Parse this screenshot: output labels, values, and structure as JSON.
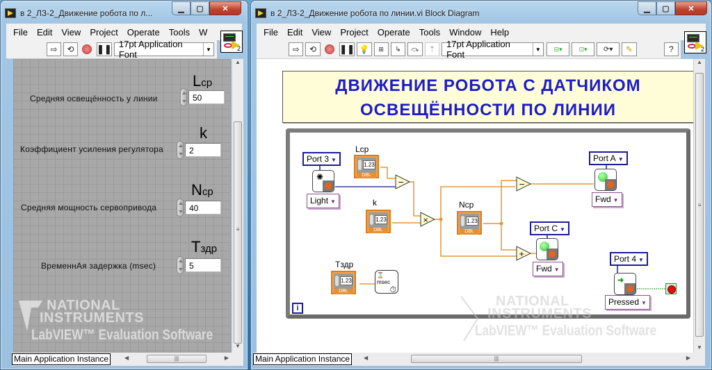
{
  "front_panel": {
    "title": "в 2_ЛЗ-2_Движение робота по л...",
    "menu": [
      "File",
      "Edit",
      "View",
      "Project",
      "Operate",
      "Tools",
      "W"
    ],
    "toolbar": {
      "font_selector": "17pt Application Font",
      "icons": [
        "run-arrow-icon",
        "run-continuously-icon",
        "abort-icon",
        "pause-icon"
      ]
    },
    "vi_icon_number": "2",
    "controls": [
      {
        "symbol": "L",
        "subscript": "cp",
        "label": "Средняя  освещённость у  линии",
        "value": "50"
      },
      {
        "symbol": "k",
        "subscript": "",
        "label": "Коэффициент  усиления регулятора",
        "value": "2"
      },
      {
        "symbol": "N",
        "subscript": "cp",
        "label": "Средняя  мощность  сервопривода",
        "value": "40"
      },
      {
        "symbol": "T",
        "subscript": "здр",
        "label": "ВременнАя  задержка  (msec)",
        "value": "5"
      }
    ],
    "status_instance": "Main Application Instance"
  },
  "block_diagram": {
    "title": "в 2_ЛЗ-2_Движение робота по линии.vi Block Diagram",
    "menu": [
      "File",
      "Edit",
      "View",
      "Project",
      "Operate",
      "Tools",
      "Window",
      "Help"
    ],
    "toolbar": {
      "font_selector": "17pt Application Font",
      "icons": [
        "run-arrow-icon",
        "run-continuously-icon",
        "abort-icon",
        "pause-icon",
        "highlight-execution-icon",
        "retain-wire-values-icon",
        "step-into-icon",
        "step-over-icon",
        "step-out-icon",
        "align-icon",
        "distribute-icon",
        "reorder-icon",
        "cleanup-icon",
        "help-icon"
      ]
    },
    "vi_icon_number": "2",
    "heading_line1": "ДВИЖЕНИЕ  РОБОТА  С  ДАТЧИКОМ",
    "heading_line2": "ОСВЕЩЁННОСТИ  ПО  ЛИНИИ",
    "terminals": {
      "lcp": {
        "label": "Lcp",
        "display": "1.23",
        "type": "DBL"
      },
      "k": {
        "label": "k",
        "display": "1.23",
        "type": "DBL"
      },
      "ncp": {
        "label": "Ncp",
        "display": "1.23",
        "type": "DBL"
      },
      "tzdr": {
        "label": "Tздр",
        "display": "1.23",
        "type": "DBL"
      }
    },
    "ports": {
      "light_sensor": {
        "port": "Port 3",
        "mode": "Light"
      },
      "motor_a": {
        "port": "Port A",
        "mode": "Fwd"
      },
      "motor_c": {
        "port": "Port C",
        "mode": "Fwd"
      },
      "touch_sensor": {
        "port": "Port 4",
        "mode": "Pressed"
      }
    },
    "operators": {
      "subtract1": "−",
      "multiply": "×",
      "subtract2": "−",
      "add": "+"
    },
    "timer_label": "msec",
    "iteration_terminal": "i",
    "status_instance": "Main Application Instance"
  },
  "watermark": {
    "line1": "NATIONAL",
    "line2": "INSTRUMENTS",
    "line3": "LabVIEW™ Evaluation Software"
  },
  "colors": {
    "heading_text": "#1c1cc8",
    "heading_bg": "#fffdd8",
    "dbl_wire": "#e0963a",
    "port_ring_border": "#1a1a9c",
    "mode_ring_border": "#8a4f8f"
  }
}
